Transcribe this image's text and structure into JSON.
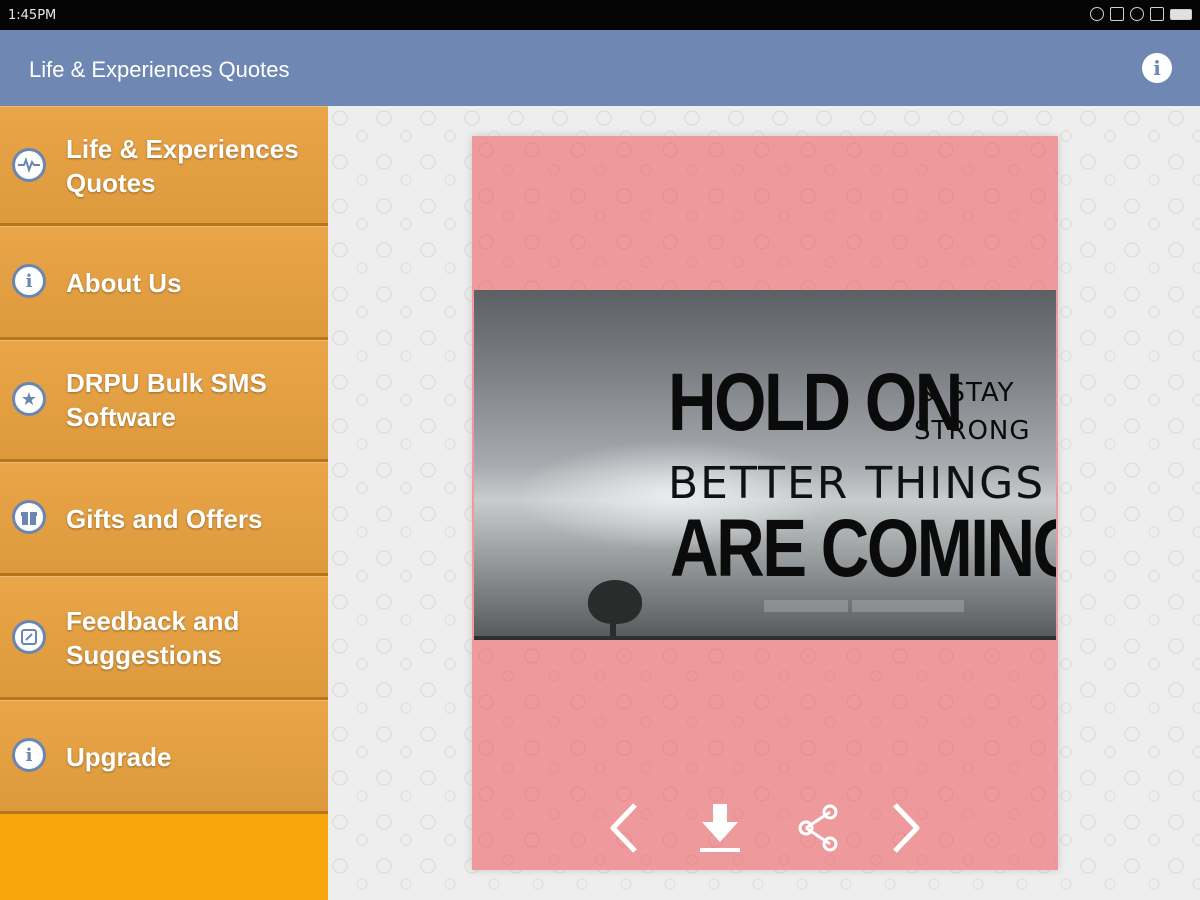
{
  "status_bar": {
    "time": "1:45PM",
    "icons": [
      "alarm-icon",
      "bluetooth-icon",
      "wifi-off-icon",
      "lock-icon",
      "battery-icon"
    ]
  },
  "action_bar": {
    "title": "Life & Experiences Quotes",
    "info_icon": "info-icon",
    "accent_color": "#6f88b3"
  },
  "drawer": {
    "background_color": "#f7a70c",
    "items": [
      {
        "label": "Life & Experiences Quotes",
        "icon": "pulse-icon"
      },
      {
        "label": "About Us",
        "icon": "info-icon"
      },
      {
        "label": "DRPU Bulk SMS Software",
        "icon": "star-icon"
      },
      {
        "label": "Gifts and Offers",
        "icon": "gift-icon"
      },
      {
        "label": "Feedback and Suggestions",
        "icon": "feedback-icon"
      },
      {
        "label": "Upgrade",
        "icon": "info-icon"
      }
    ]
  },
  "quote_card": {
    "background_color": "#ee9a9c",
    "quote": {
      "line1": "HOLD ON",
      "line1_side_a": "& STAY",
      "line1_side_b": "STRONG",
      "line2": "BETTER THINGS",
      "line3": "ARE COMING"
    },
    "controls": [
      "previous-icon",
      "download-icon",
      "share-icon",
      "next-icon"
    ]
  }
}
